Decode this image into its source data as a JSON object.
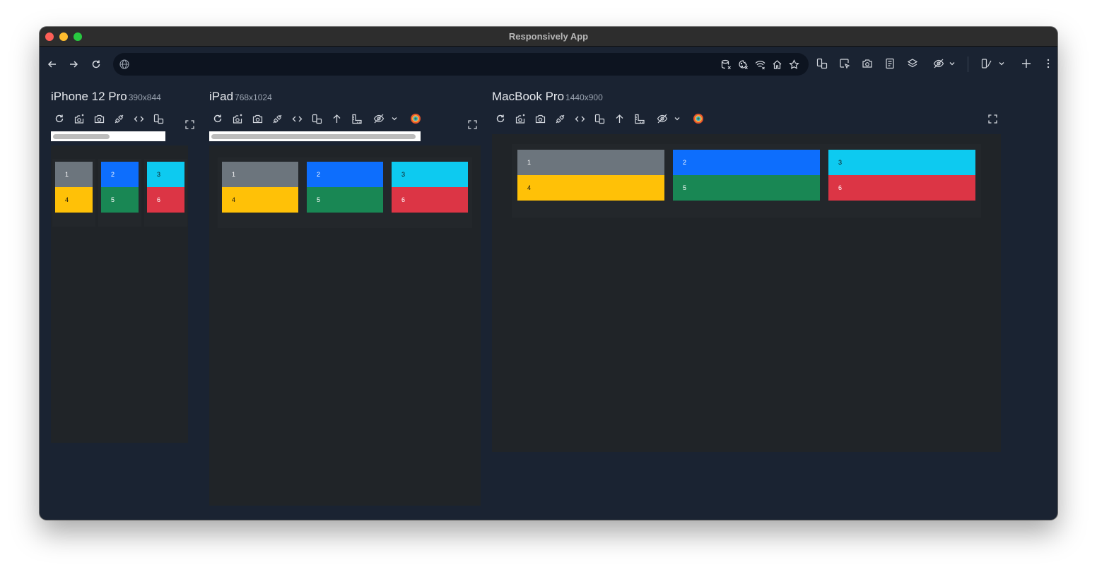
{
  "window": {
    "title": "Responsively App"
  },
  "toolbar": {
    "url_value": "",
    "url_placeholder": ""
  },
  "devices": [
    {
      "name": "iPhone 12 Pro",
      "dims": "390x844"
    },
    {
      "name": "iPad",
      "dims": "768x1024"
    },
    {
      "name": "MacBook Pro",
      "dims": "1440x900"
    }
  ],
  "grid": {
    "cells": [
      {
        "label": "1",
        "color": "#6c757d"
      },
      {
        "label": "2",
        "color": "#0d6efd"
      },
      {
        "label": "3",
        "color": "#0dcaf0"
      },
      {
        "label": "4",
        "color": "#ffc107"
      },
      {
        "label": "5",
        "color": "#198754"
      },
      {
        "label": "6",
        "color": "#dc3545"
      }
    ]
  },
  "icons": {
    "toolbar": [
      "arrow-left-icon",
      "arrow-right-icon",
      "reload-icon",
      "globe-icon",
      "clear-cache-icon",
      "delete-cookies-icon",
      "network-offline-icon",
      "home-icon",
      "bookmark-star-icon",
      "rotate-devices-icon",
      "inspect-element-icon",
      "screenshot-icon",
      "preview-layout-icon",
      "layers-icon",
      "hide-icon",
      "chevron-down-icon",
      "layout-icon",
      "add-icon",
      "more-vertical-icon"
    ],
    "device": [
      "reload-icon",
      "screenshot-scroll-icon",
      "screenshot-icon",
      "disable-ssl-icon",
      "devtools-icon",
      "rotate-icon",
      "scroll-top-icon",
      "ruler-icon",
      "hide-icon",
      "chevron-down-icon",
      "color-blindness-icon",
      "fullscreen-icon"
    ]
  }
}
